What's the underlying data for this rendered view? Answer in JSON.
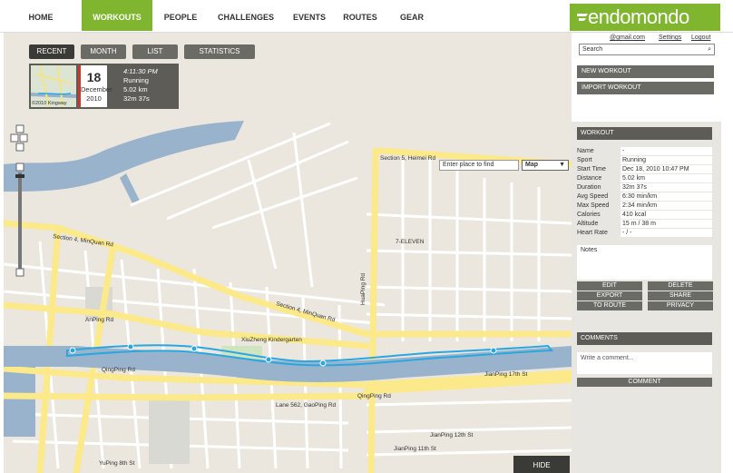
{
  "nav": {
    "items": [
      {
        "label": "HOME"
      },
      {
        "label": "WORKOUTS"
      },
      {
        "label": "PEOPLE"
      },
      {
        "label": "CHALLENGES"
      },
      {
        "label": "EVENTS"
      },
      {
        "label": "ROUTES"
      },
      {
        "label": "GEAR"
      }
    ],
    "logo_text": "endomondo"
  },
  "filters": [
    "RECENT",
    "MONTH",
    "LIST",
    "STATISTICS"
  ],
  "workout_card": {
    "thumb_caption": "©2010 Kingway",
    "day": "18",
    "month": "December",
    "year": "2010",
    "time": "4:11:30 PM",
    "sport": "Running",
    "distance": "5.02 km",
    "duration": "32m 37s"
  },
  "map": {
    "search_placeholder": "Enter place to find",
    "type_selected": "Map",
    "hide_label": "HIDE",
    "labels": {
      "section5": "Section 5, Heimei Rd",
      "section4_minquan": "Section 4, MinQuan Rd",
      "section4_minquan2": "Section 4, MinQuan Rd",
      "anping": "AnPing Rd",
      "qingping": "QingPing Rd",
      "qingping2": "QingPing Rd",
      "jianping": "JianPing 17th St",
      "seven_eleven": "7-ELEVEN",
      "xiuzheng": "XiuZheng Kindergarten",
      "yuping": "YuPing 8th St",
      "huaping": "HuaPing Rd",
      "lane562": "Lane 562, GaoPing Rd",
      "jianping12": "JianPing 12th St",
      "jianping11": "JianPing 11th St"
    }
  },
  "side": {
    "email": "@gmail.com",
    "settings": "Settings",
    "logout": "Logout",
    "search_placeholder": "Search",
    "new_workout": "NEW WORKOUT",
    "import_workout": "IMPORT WORKOUT",
    "workout_head": "WORKOUT",
    "stats": [
      {
        "k": "Name",
        "v": "-"
      },
      {
        "k": "Sport",
        "v": "Running"
      },
      {
        "k": "Start Time",
        "v": "Dec 18, 2010 10:47 PM"
      },
      {
        "k": "Distance",
        "v": "5.02 km"
      },
      {
        "k": "Duration",
        "v": "32m 37s"
      },
      {
        "k": "Avg Speed",
        "v": "6:30 min/km"
      },
      {
        "k": "Max Speed",
        "v": "2:34 min/km"
      },
      {
        "k": "Calories",
        "v": "410 kcal"
      },
      {
        "k": "Altitude",
        "v": "15 m / 38 m"
      },
      {
        "k": "Heart Rate",
        "v": "- / -"
      }
    ],
    "notes_label": "Notes",
    "actions": {
      "edit": "EDIT",
      "delete": "DELETE",
      "export": "EXPORT",
      "share": "SHARE",
      "to_route": "TO ROUTE",
      "privacy": "PRIVACY"
    },
    "comments_head": "COMMENTS",
    "comment_placeholder": "Write a comment...",
    "comment_btn": "COMMENT"
  },
  "colors": {
    "brand_green": "#7fb52f",
    "route_blue": "#2aa7e0",
    "river": "#99b3cc",
    "major_road": "#fbe98a"
  }
}
